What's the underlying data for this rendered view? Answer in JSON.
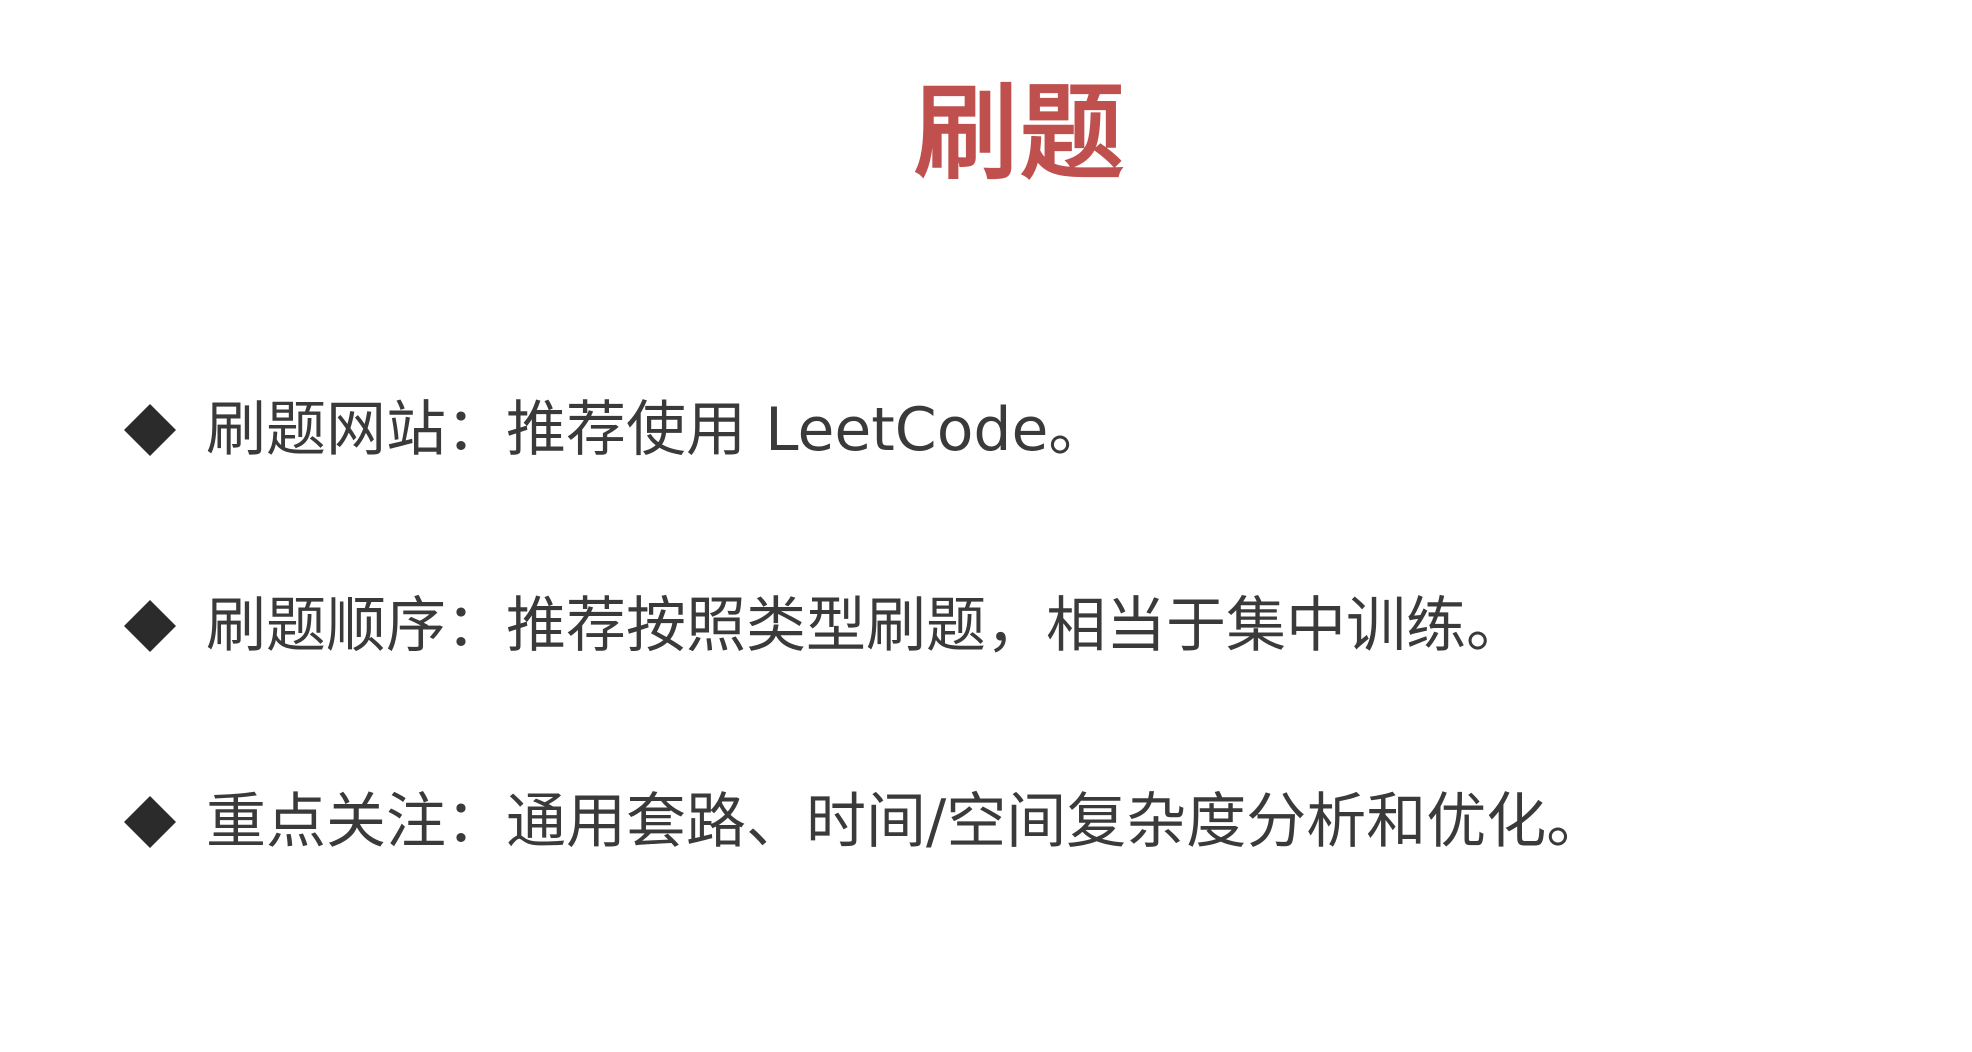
{
  "slide": {
    "title": "刷题",
    "title_color": "#c0504d",
    "text_color": "#3a3a3a",
    "bullet_icon": "diamond-icon",
    "bullets": [
      {
        "text": "刷题网站：推荐使用 LeetCode。"
      },
      {
        "text": "刷题顺序：推荐按照类型刷题，相当于集中训练。"
      },
      {
        "text": "重点关注：通用套路、时间/空间复杂度分析和优化。"
      }
    ]
  }
}
